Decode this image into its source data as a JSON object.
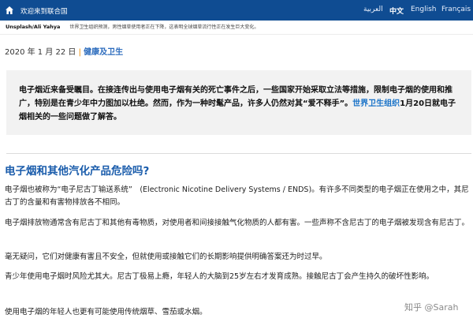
{
  "topbar": {
    "welcome": "欢迎来到联合国",
    "languages": [
      "العربية",
      "中文",
      "English",
      "Français"
    ],
    "active_language": "中文",
    "bg_color": "#0f4c92"
  },
  "caption": {
    "credit": "Unsplash/Ali Yahya",
    "text": "世界卫生组织预测，男性烟草使用者正在下降，这表明全球烟草流行性正在发生巨大变化。"
  },
  "article": {
    "date": "2020 年 1 月 22 日",
    "category": "健康及卫生",
    "intro_before_link": "电子烟近来备受瞩目。在接连传出与使用电子烟有关的死亡事件之后，一些国家开始采取立法等措施，限制电子烟的使用和推广，特别是在青少年中力图加以杜绝。然而，作为一种时髦产品，许多人仍然对其“爱不释手”。",
    "intro_link": "世界卫生组织",
    "intro_after_link": "1月20日就电子烟相关的一些问题做了解答。",
    "heading": "电子烟和其他汽化产品危险吗?",
    "paragraphs": [
      "电子烟也被称为“电子尼古丁输送系统”　(Electronic Nicotine Delivery Systems / ENDS)。有许多不同类型的电子烟正在使用之中，其尼古丁的含量和有害物排放各不相同。",
      "电子烟排放物通常含有尼古丁和其他有毒物质，对使用者和间接接触气化物质的人都有害。一些声称不含尼古丁的电子烟被发现含有尼古丁。",
      "毫无疑问，它们对健康有害且不安全，但就使用或接触它们的长期影响提供明确答案还为时过早。",
      "青少年使用电子烟时风险尤其大。尼古丁极易上瘾，年轻人的大脑到25岁左右才发育成熟。接触尼古丁会产生持久的破坏性影响。",
      "使用电子烟的年轻人也更有可能使用传统烟草、雪茄或水烟。"
    ]
  },
  "watermark": "知乎 @Sarah",
  "colors": {
    "link_blue": "#1a73c8",
    "heading_blue": "#1a5cab",
    "intro_bg": "#f2f2f2",
    "accent_orange": "#f2a93b"
  }
}
